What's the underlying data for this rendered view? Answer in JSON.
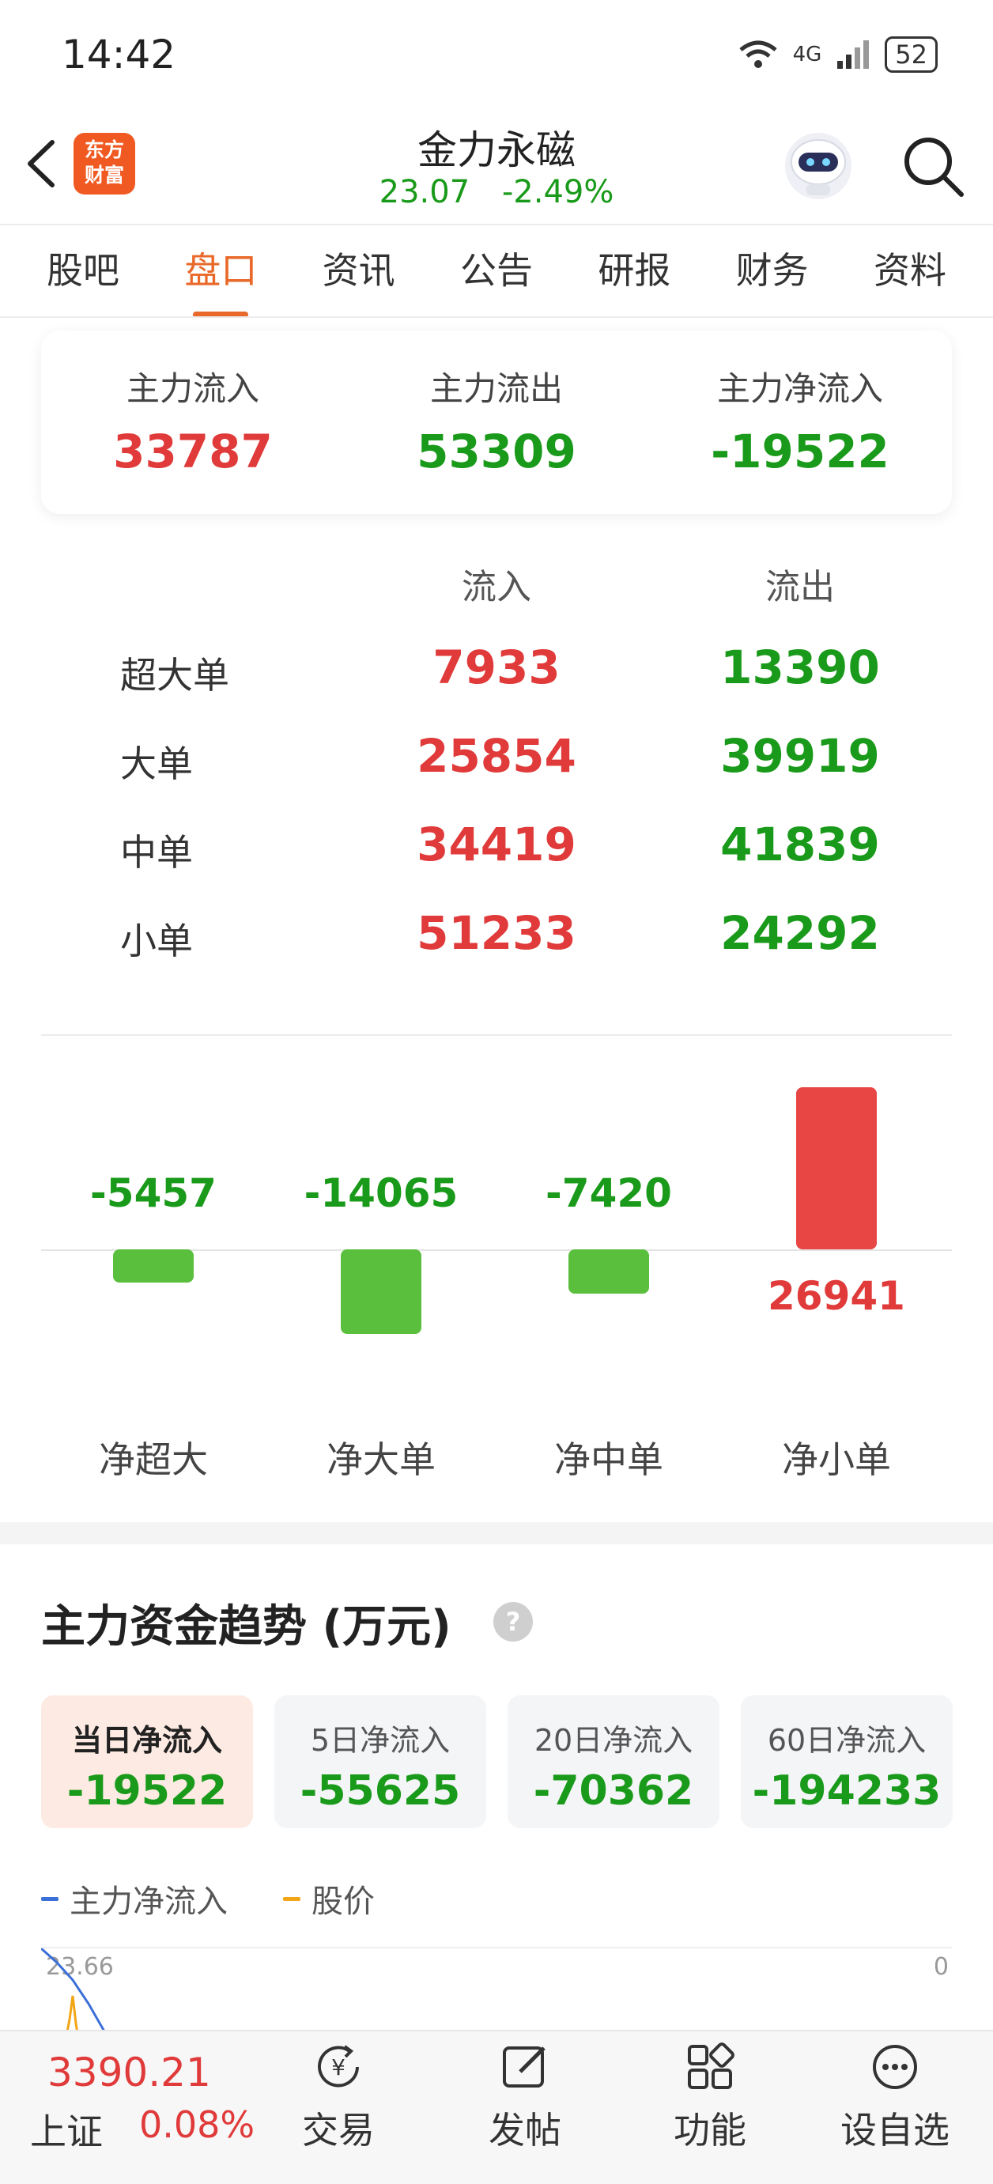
{
  "status_bar": {
    "time": "14:42",
    "network": "4G",
    "battery": "52"
  },
  "header": {
    "logo_text_line1": "东方",
    "logo_text_line2": "财富",
    "title": "金力永磁",
    "price": "23.07",
    "change_pct": "-2.49%"
  },
  "tabs": [
    {
      "label": "股吧",
      "active": false
    },
    {
      "label": "盘口",
      "active": true
    },
    {
      "label": "资讯",
      "active": false
    },
    {
      "label": "公告",
      "active": false
    },
    {
      "label": "研报",
      "active": false
    },
    {
      "label": "财务",
      "active": false
    },
    {
      "label": "资料",
      "active": false
    }
  ],
  "summary": [
    {
      "label": "主力流入",
      "value": "33787"
    },
    {
      "label": "主力流出",
      "value": "53309"
    },
    {
      "label": "主力净流入",
      "value": "-19522"
    }
  ],
  "flow_table": {
    "headers": [
      "流入",
      "流出"
    ],
    "rows": [
      {
        "label": "超大单",
        "inflow": "7933",
        "outflow": "13390"
      },
      {
        "label": "大单",
        "inflow": "25854",
        "outflow": "39919"
      },
      {
        "label": "中单",
        "inflow": "34419",
        "outflow": "41839"
      },
      {
        "label": "小单",
        "inflow": "51233",
        "outflow": "24292"
      }
    ]
  },
  "net_bars": [
    {
      "label": "净超大",
      "value": -5457
    },
    {
      "label": "净大单",
      "value": -14065
    },
    {
      "label": "净中单",
      "value": -7420
    },
    {
      "label": "净小单",
      "value": 26941
    }
  ],
  "trend": {
    "title": "主力资金趋势 (万元)",
    "tabs": [
      {
        "label": "当日净流入",
        "value": "-19522",
        "active": true
      },
      {
        "label": "5日净流入",
        "value": "-55625",
        "active": false
      },
      {
        "label": "20日净流入",
        "value": "-70362",
        "active": false
      },
      {
        "label": "60日净流入",
        "value": "-194233",
        "active": false
      }
    ],
    "legend": [
      {
        "label": "主力净流入",
        "color": "#3b6fd8"
      },
      {
        "label": "股价",
        "color": "#f2a516"
      }
    ],
    "y_left_top": "23.66",
    "y_right_top": "0"
  },
  "colors": {
    "up": "#e03a3a",
    "down": "#1a9a1a",
    "bar_up": "#e84545",
    "bar_down": "#5bbf3e",
    "accent": "#e9692a"
  },
  "bottom_nav": {
    "index_value": "3390.21",
    "index_name": "上证",
    "index_pct": "0.08%",
    "items": [
      {
        "label": "交易",
        "icon": "yen-icon"
      },
      {
        "label": "发帖",
        "icon": "edit-icon"
      },
      {
        "label": "功能",
        "icon": "grid-icon"
      },
      {
        "label": "设自选",
        "icon": "more-icon"
      }
    ]
  }
}
